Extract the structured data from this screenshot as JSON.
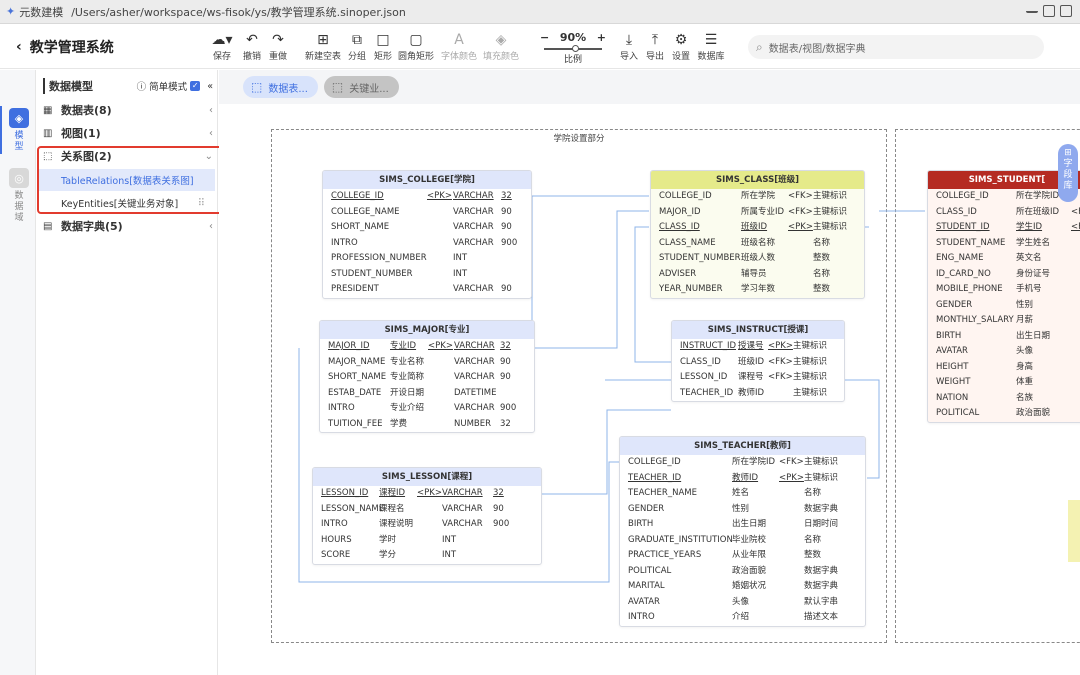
{
  "titlebar": {
    "app_name": "元数建模",
    "path": "/Users/asher/workspace/ws-fisok/ys/教学管理系统.sinoper.json"
  },
  "header": {
    "back_title": "教学管理系统"
  },
  "toolbar": {
    "items": [
      {
        "icon": "save-icon",
        "label": "保存"
      },
      {
        "icon": "undo-icon",
        "label": "撤销"
      },
      {
        "icon": "redo-icon",
        "label": "重做"
      },
      {
        "icon": "new-table-icon",
        "label": "新建空表"
      },
      {
        "icon": "group-icon",
        "label": "分组"
      },
      {
        "icon": "rect-icon",
        "label": "矩形"
      },
      {
        "icon": "round-rect-icon",
        "label": "圆角矩形"
      },
      {
        "icon": "font-color-icon",
        "label": "字体颜色"
      },
      {
        "icon": "fill-color-icon",
        "label": "填充颜色"
      },
      {
        "icon": "import-icon",
        "label": "导入"
      },
      {
        "icon": "export-icon",
        "label": "导出"
      },
      {
        "icon": "settings-icon",
        "label": "设置"
      },
      {
        "icon": "database-icon",
        "label": "数据库"
      }
    ],
    "zoom_value": "90%",
    "zoom_label": "比例",
    "search_placeholder": "数据表/视图/数据字典"
  },
  "rail": {
    "model": "模型",
    "domain": "数据域"
  },
  "tree": {
    "header": "数据模型",
    "simple_mode": "简单模式",
    "nodes": {
      "tables": "数据表(8)",
      "views": "视图(1)",
      "relations": "关系图(2)",
      "dict": "数据字典(5)"
    },
    "relation_children": [
      "TableRelations[数据表关系图]",
      "KeyEntities[关键业务对象]"
    ]
  },
  "canvas": {
    "tabs": [
      "数据表...",
      "关键业..."
    ],
    "group_title": "学院设置部分",
    "side_tab": "字段库"
  },
  "entities": {
    "college": {
      "title": "SIMS_COLLEGE[学院]",
      "rows": [
        [
          "COLLEGE_ID",
          "",
          "<PK>",
          "VARCHAR",
          "32"
        ],
        [
          "COLLEGE_NAME",
          "",
          "",
          "VARCHAR",
          "90"
        ],
        [
          "SHORT_NAME",
          "",
          "",
          "VARCHAR",
          "90"
        ],
        [
          "INTRO",
          "",
          "",
          "VARCHAR",
          "900"
        ],
        [
          "PROFESSION_NUMBER",
          "",
          "",
          "INT",
          ""
        ],
        [
          "STUDENT_NUMBER",
          "",
          "",
          "INT",
          ""
        ],
        [
          "PRESIDENT",
          "",
          "",
          "VARCHAR",
          "90"
        ]
      ]
    },
    "class": {
      "title": "SIMS_CLASS[班级]",
      "rows": [
        [
          "COLLEGE_ID",
          "所在学院",
          "<FK>",
          "主键标识",
          ""
        ],
        [
          "MAJOR_ID",
          "所属专业ID",
          "<FK>",
          "主键标识",
          ""
        ],
        [
          "CLASS_ID",
          "班级ID",
          "<PK>",
          "主键标识",
          ""
        ],
        [
          "CLASS_NAME",
          "班级名称",
          "",
          "名称",
          ""
        ],
        [
          "STUDENT_NUMBER",
          "班级人数",
          "",
          "整数",
          ""
        ],
        [
          "ADVISER",
          "辅导员",
          "",
          "名称",
          ""
        ],
        [
          "YEAR_NUMBER",
          "学习年数",
          "",
          "整数",
          ""
        ]
      ]
    },
    "major": {
      "title": "SIMS_MAJOR[专业]",
      "rows": [
        [
          "MAJOR_ID",
          "专业ID",
          "<PK>",
          "VARCHAR",
          "32"
        ],
        [
          "MAJOR_NAME",
          "专业名称",
          "",
          "VARCHAR",
          "90"
        ],
        [
          "SHORT_NAME",
          "专业简称",
          "",
          "VARCHAR",
          "90"
        ],
        [
          "ESTAB_DATE",
          "开设日期",
          "",
          "DATETIME",
          ""
        ],
        [
          "INTRO",
          "专业介绍",
          "",
          "VARCHAR",
          "900"
        ],
        [
          "TUITION_FEE",
          "学费",
          "",
          "NUMBER",
          "32"
        ]
      ]
    },
    "instruct": {
      "title": "SIMS_INSTRUCT[授课]",
      "rows": [
        [
          "INSTRUCT_ID",
          "授课号",
          "<PK>",
          "主键标识",
          ""
        ],
        [
          "CLASS_ID",
          "班级ID",
          "<FK>",
          "主键标识",
          ""
        ],
        [
          "LESSON_ID",
          "课程号",
          "<FK>",
          "主键标识",
          ""
        ],
        [
          "TEACHER_ID",
          "教师ID",
          "",
          "主键标识",
          ""
        ]
      ]
    },
    "lesson": {
      "title": "SIMS_LESSON[课程]",
      "rows": [
        [
          "LESSON_ID",
          "课程ID",
          "<PK>",
          "VARCHAR",
          "32"
        ],
        [
          "LESSON_NAME",
          "课程名",
          "",
          "VARCHAR",
          "90"
        ],
        [
          "INTRO",
          "课程说明",
          "",
          "VARCHAR",
          "900"
        ],
        [
          "HOURS",
          "学时",
          "",
          "INT",
          ""
        ],
        [
          "SCORE",
          "学分",
          "",
          "INT",
          ""
        ]
      ]
    },
    "teacher": {
      "title": "SIMS_TEACHER[教师]",
      "rows": [
        [
          "COLLEGE_ID",
          "所在学院ID",
          "<FK>",
          "主键标识",
          ""
        ],
        [
          "TEACHER_ID",
          "教师ID",
          "<PK>",
          "主键标识",
          ""
        ],
        [
          "TEACHER_NAME",
          "姓名",
          "",
          "名称",
          ""
        ],
        [
          "GENDER",
          "性别",
          "",
          "数据字典",
          ""
        ],
        [
          "BIRTH",
          "出生日期",
          "",
          "日期时间",
          ""
        ],
        [
          "GRADUATE_INSTITUTION",
          "毕业院校",
          "",
          "名称",
          ""
        ],
        [
          "PRACTICE_YEARS",
          "从业年限",
          "",
          "整数",
          ""
        ],
        [
          "POLITICAL",
          "政治面貌",
          "",
          "数据字典",
          ""
        ],
        [
          "MARITAL",
          "婚姻状况",
          "",
          "数据字典",
          ""
        ],
        [
          "AVATAR",
          "头像",
          "",
          "默认字串",
          ""
        ],
        [
          "INTRO",
          "介绍",
          "",
          "描述文本",
          ""
        ]
      ]
    },
    "student": {
      "title": "SIMS_STUDENT[",
      "rows": [
        [
          "COLLEGE_ID",
          "所在学院ID",
          ""
        ],
        [
          "CLASS_ID",
          "所在班级ID",
          "<F"
        ],
        [
          "STUDENT_ID",
          "学生ID",
          "<F"
        ],
        [
          "STUDENT_NAME",
          "学生姓名",
          ""
        ],
        [
          "ENG_NAME",
          "英文名",
          ""
        ],
        [
          "ID_CARD_NO",
          "身份证号",
          ""
        ],
        [
          "MOBILE_PHONE",
          "手机号",
          ""
        ],
        [
          "GENDER",
          "性别",
          ""
        ],
        [
          "MONTHLY_SALARY",
          "月薪",
          ""
        ],
        [
          "BIRTH",
          "出生日期",
          ""
        ],
        [
          "AVATAR",
          "头像",
          ""
        ],
        [
          "HEIGHT",
          "身高",
          ""
        ],
        [
          "WEIGHT",
          "体重",
          ""
        ],
        [
          "NATION",
          "名族",
          ""
        ],
        [
          "POLITICAL",
          "政治面貌",
          ""
        ]
      ]
    }
  }
}
